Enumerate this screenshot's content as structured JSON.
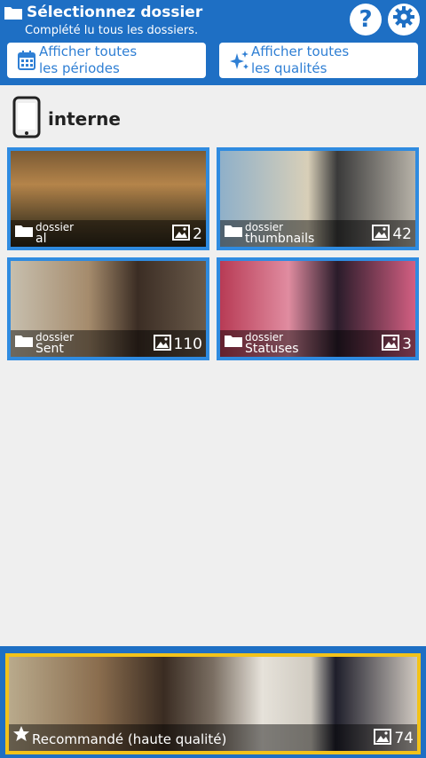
{
  "header": {
    "title": "Sélectionnez dossier",
    "subtitle": "Complété lu tous les dossiers.",
    "help_label": "?",
    "filter_periods_label": "Afficher toutes\nles périodes",
    "filter_qualities_label": "Afficher toutes\nles qualités"
  },
  "storage": {
    "label": "interne",
    "icon": "phone-icon"
  },
  "folders": [
    {
      "kind": "dossier",
      "name": "al",
      "count": "2"
    },
    {
      "kind": "dossier",
      "name": "thumbnails",
      "count": "42"
    },
    {
      "kind": "dossier",
      "name": "Sent",
      "count": "110"
    },
    {
      "kind": "dossier",
      "name": "Statuses",
      "count": "3"
    }
  ],
  "recommended": {
    "label": "Recommandé (haute qualité)",
    "count": "74"
  },
  "colors": {
    "accent": "#1e6fc4",
    "tile_border": "#2f8be0",
    "featured_border": "#f2c21a"
  }
}
